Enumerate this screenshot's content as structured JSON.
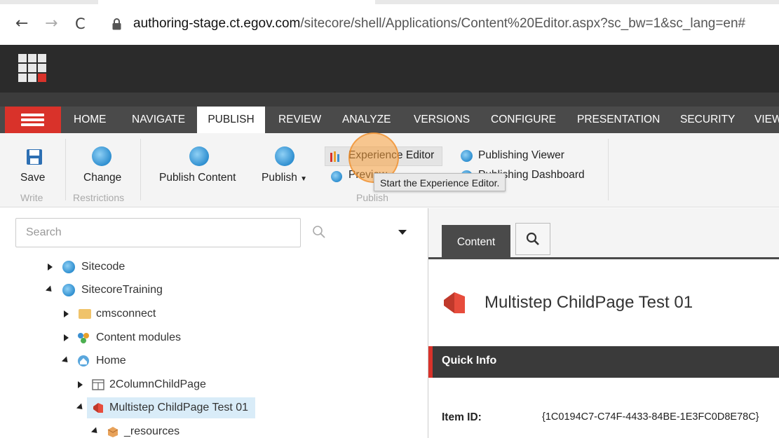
{
  "browser": {
    "back_glyph": "←",
    "forward_glyph": "→",
    "reload_glyph": "C",
    "url_host": "authoring-stage.ct.egov.com",
    "url_path": "/sitecore/shell/Applications/Content%20Editor.aspx?sc_bw=1&sc_lang=en#"
  },
  "ribbon_tabs": [
    "HOME",
    "NAVIGATE",
    "PUBLISH",
    "REVIEW",
    "ANALYZE",
    "VERSIONS",
    "CONFIGURE",
    "PRESENTATION",
    "SECURITY",
    "VIEW"
  ],
  "active_tab": "PUBLISH",
  "ribbon": {
    "save_label": "Save",
    "write_group": "Write",
    "change_label": "Change",
    "restrictions_group": "Restrictions",
    "publish_content_label": "Publish Content",
    "publish_label": "Publish",
    "experience_editor_label": "Experience Editor",
    "preview_label": "Preview",
    "publishing_viewer_label": "Publishing Viewer",
    "publishing_dashboard_label": "Publishing Dashboard",
    "publish_group": "Publish",
    "tooltip": "Start the Experience Editor."
  },
  "search": {
    "placeholder": "Search"
  },
  "tree": [
    {
      "label": "Sitecode",
      "icon": "globe-icon",
      "expanded": false
    },
    {
      "label": "SitecoreTraining",
      "icon": "globe-icon",
      "expanded": true
    },
    {
      "label": "cmsconnect",
      "icon": "folder-icon",
      "expanded": false
    },
    {
      "label": "Content modules",
      "icon": "modules-icon",
      "expanded": false
    },
    {
      "label": "Home",
      "icon": "home-icon",
      "expanded": true
    },
    {
      "label": "2ColumnChildPage",
      "icon": "page-icon",
      "expanded": false
    },
    {
      "label": "Multistep ChildPage Test 01",
      "icon": "multistep-icon",
      "expanded": true,
      "selected": true
    },
    {
      "label": "_resources",
      "icon": "box-icon",
      "expanded": true
    }
  ],
  "content": {
    "tab_label": "Content",
    "item_title": "Multistep ChildPage Test 01",
    "quick_info_label": "Quick Info",
    "item_id_label": "Item ID:",
    "item_id_value": "{1C0194C7-C74F-4433-84BE-1E3FC0D8E78C}"
  },
  "colors": {
    "accent_red": "#d9322a",
    "dark_header": "#2b2b2b",
    "tab_bar": "#4a4a4a",
    "selection": "#d9ecf8"
  }
}
